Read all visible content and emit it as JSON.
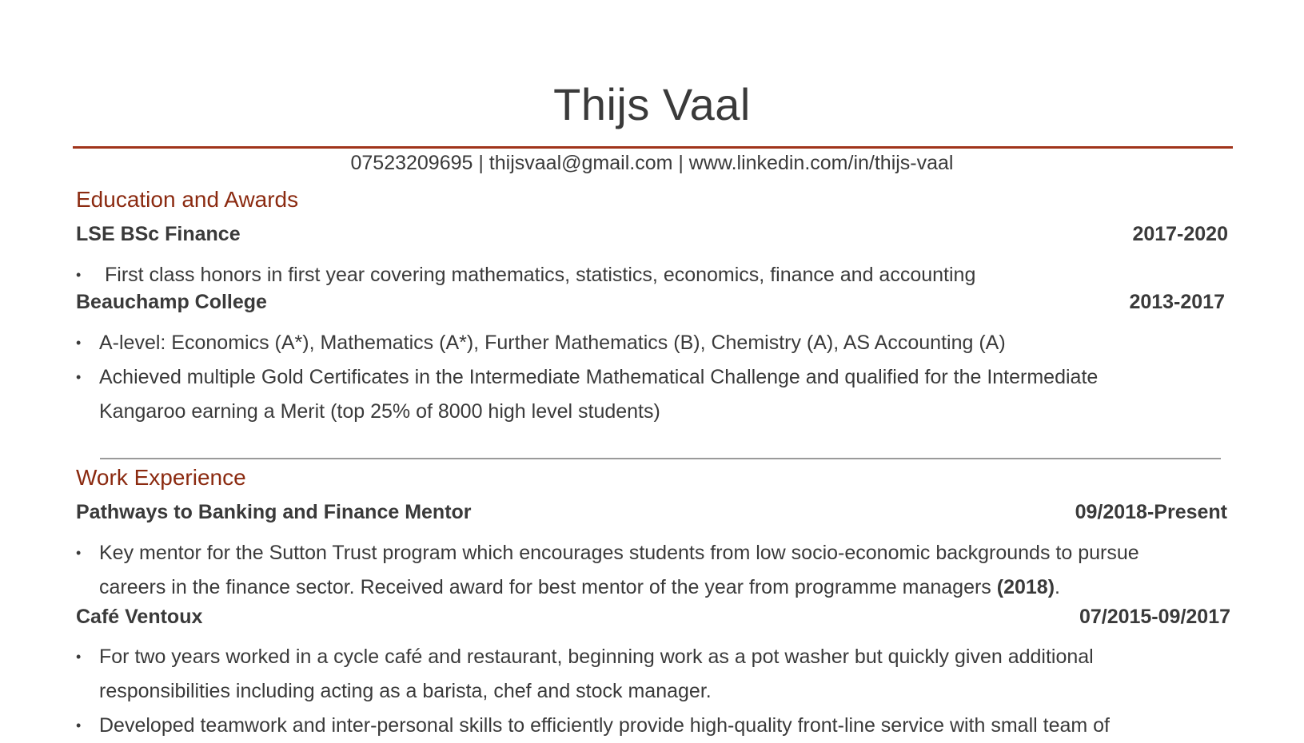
{
  "header": {
    "name": "Thijs Vaal",
    "contact": "07523209695 | thijsvaal@gmail.com | www.linkedin.com/in/thijs-vaal",
    "accent_color": "#a0341b"
  },
  "education": {
    "title": "Education and Awards",
    "entries": [
      {
        "name": "LSE BSc Finance",
        "date": "2017-2020",
        "bullets": [
          [
            "First class honors in first year covering mathematics, statistics, economics, finance and accounting"
          ]
        ]
      },
      {
        "name": "Beauchamp College",
        "date": "2013-2017",
        "bullets": [
          [
            "A-level: Economics (A*), Mathematics (A*), Further Mathematics (B), Chemistry (A), AS Accounting (A)"
          ],
          [
            "Achieved multiple Gold Certificates in the Intermediate Mathematical Challenge and qualified for the Intermediate",
            "Kangaroo earning a Merit (top 25% of 8000 high level students)"
          ]
        ]
      }
    ]
  },
  "work": {
    "title": "Work Experience",
    "entries": [
      {
        "name": "Pathways to Banking and Finance Mentor",
        "date": "09/2018-Present",
        "bullets": [
          [
            "Key mentor for the Sutton Trust program which encourages students from low socio-economic backgrounds to pursue",
            "careers in the finance sector. Received award for best mentor of the year from programme managers ",
            "(2018)",
            "."
          ]
        ]
      },
      {
        "name": "Café Ventoux",
        "date": "07/2015-09/2017",
        "bullets": [
          [
            "For two years worked in a cycle café and restaurant, beginning work as a pot washer but quickly given additional",
            "responsibilities including acting as a barista, chef and stock manager."
          ],
          [
            "Developed teamwork and inter-personal skills to efficiently provide high-quality front-line service with small team of"
          ]
        ]
      }
    ]
  }
}
